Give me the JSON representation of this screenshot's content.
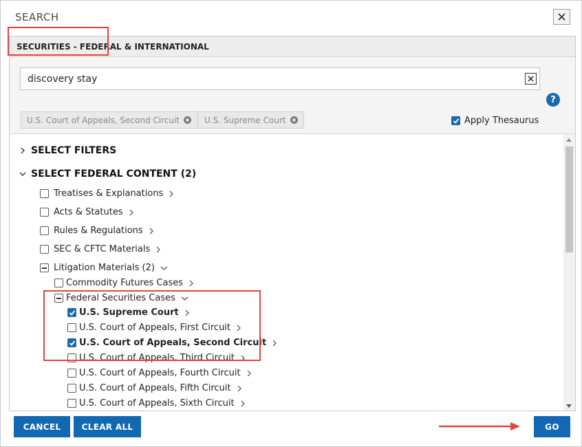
{
  "dialog": {
    "title": "SEARCH",
    "close_label": "✕"
  },
  "panel": {
    "header": "SECURITIES - FEDERAL & INTERNATIONAL"
  },
  "search": {
    "value": "discovery stay",
    "help_label": "?"
  },
  "thesaurus": {
    "label": "Apply Thesaurus",
    "checked": true
  },
  "chips": [
    {
      "label": "U.S. Court of Appeals, Second Circuit"
    },
    {
      "label": "U.S. Supreme Court"
    }
  ],
  "tree": {
    "select_filters": "SELECT FILTERS",
    "select_federal": "SELECT FEDERAL CONTENT (2)",
    "items": [
      {
        "label": "Treatises & Explanations",
        "state": "unchecked"
      },
      {
        "label": "Acts & Statutes",
        "state": "unchecked"
      },
      {
        "label": "Rules & Regulations",
        "state": "unchecked"
      },
      {
        "label": "SEC & CFTC Materials",
        "state": "unchecked"
      },
      {
        "label": "Litigation Materials (2)",
        "state": "partial"
      },
      {
        "label": "Commodity Futures Cases",
        "state": "unchecked"
      },
      {
        "label": "Federal Securities Cases",
        "state": "partial"
      },
      {
        "label": "U.S. Supreme Court",
        "state": "checked"
      },
      {
        "label": "U.S. Court of Appeals, First Circuit",
        "state": "unchecked"
      },
      {
        "label": "U.S. Court of Appeals, Second Circuit",
        "state": "checked"
      },
      {
        "label": "U.S. Court of Appeals, Third Circuit",
        "state": "unchecked"
      },
      {
        "label": "U.S. Court of Appeals, Fourth Circuit",
        "state": "unchecked"
      },
      {
        "label": "U.S. Court of Appeals, Fifth Circuit",
        "state": "unchecked"
      },
      {
        "label": "U.S. Court of Appeals, Sixth Circuit",
        "state": "unchecked"
      }
    ]
  },
  "buttons": {
    "cancel": "CANCEL",
    "clear_all": "CLEAR ALL",
    "go": "GO"
  },
  "colors": {
    "accent": "#1268b3",
    "highlight": "#e8413a"
  }
}
